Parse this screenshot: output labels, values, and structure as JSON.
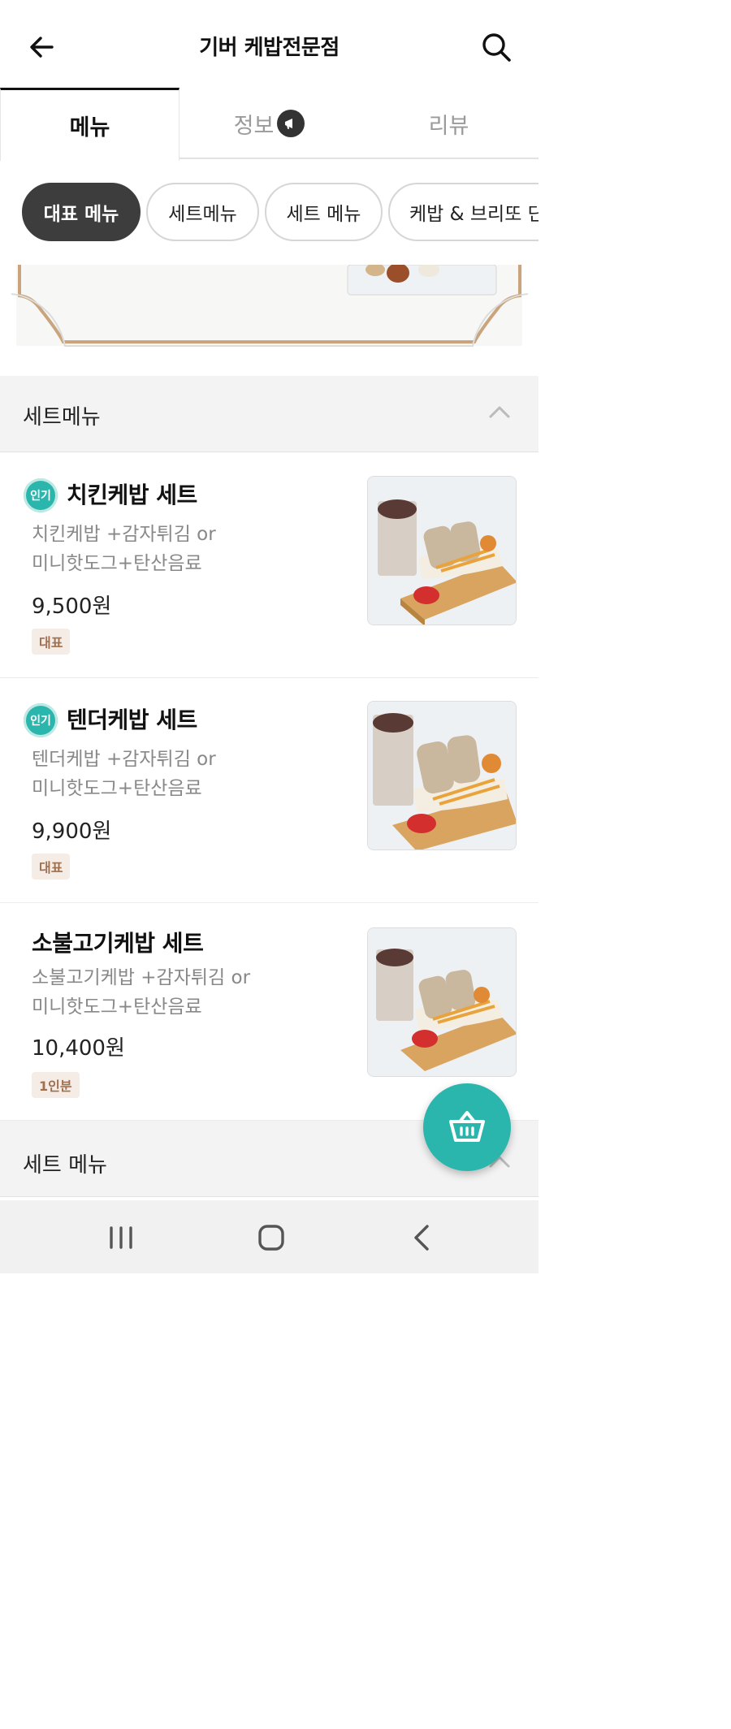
{
  "header": {
    "title": "기버 케밥전문점",
    "back_icon": "arrow-left-icon",
    "search_icon": "search-icon"
  },
  "tabs": [
    {
      "label": "메뉴",
      "active": true
    },
    {
      "label": "정보",
      "active": false,
      "icon": "megaphone-icon"
    },
    {
      "label": "리뷰",
      "active": false
    }
  ],
  "chips": [
    {
      "label": "대표 메뉴",
      "active": true
    },
    {
      "label": "세트메뉴",
      "active": false
    },
    {
      "label": "세트 메뉴",
      "active": false
    },
    {
      "label": "케밥 & 브리또 단",
      "active": false
    }
  ],
  "sections": [
    {
      "label": "세트메뉴",
      "expanded": true
    },
    {
      "label": "세트 메뉴",
      "expanded": true
    }
  ],
  "items": [
    {
      "popular_badge": "인기",
      "name": "치킨케밥 세트",
      "desc_line1": "치킨케밥 +감자튀김 or",
      "desc_line2": "미니핫도그+탄산음료",
      "price": "9,500원",
      "tag": "대표"
    },
    {
      "popular_badge": "인기",
      "name": "텐더케밥 세트",
      "desc_line1": "텐더케밥 +감자튀김 or",
      "desc_line2": "미니핫도그+탄산음료",
      "price": "9,900원",
      "tag": "대표"
    },
    {
      "name": "소불고기케밥 세트",
      "desc_line1": "소불고기케밥 +감자튀김 or",
      "desc_line2": "미니핫도그+탄산음료",
      "price": "10,400원",
      "tag": "1인분"
    }
  ],
  "colors": {
    "accent": "#2bb6ad",
    "chip_active": "#3d3d3d",
    "tag_bg": "#f5ece6",
    "tag_text": "#a0704f"
  },
  "fab": {
    "icon": "shopping-basket-icon"
  },
  "navbar": {
    "icons": [
      "recent-apps-icon",
      "home-icon",
      "back-icon"
    ]
  }
}
